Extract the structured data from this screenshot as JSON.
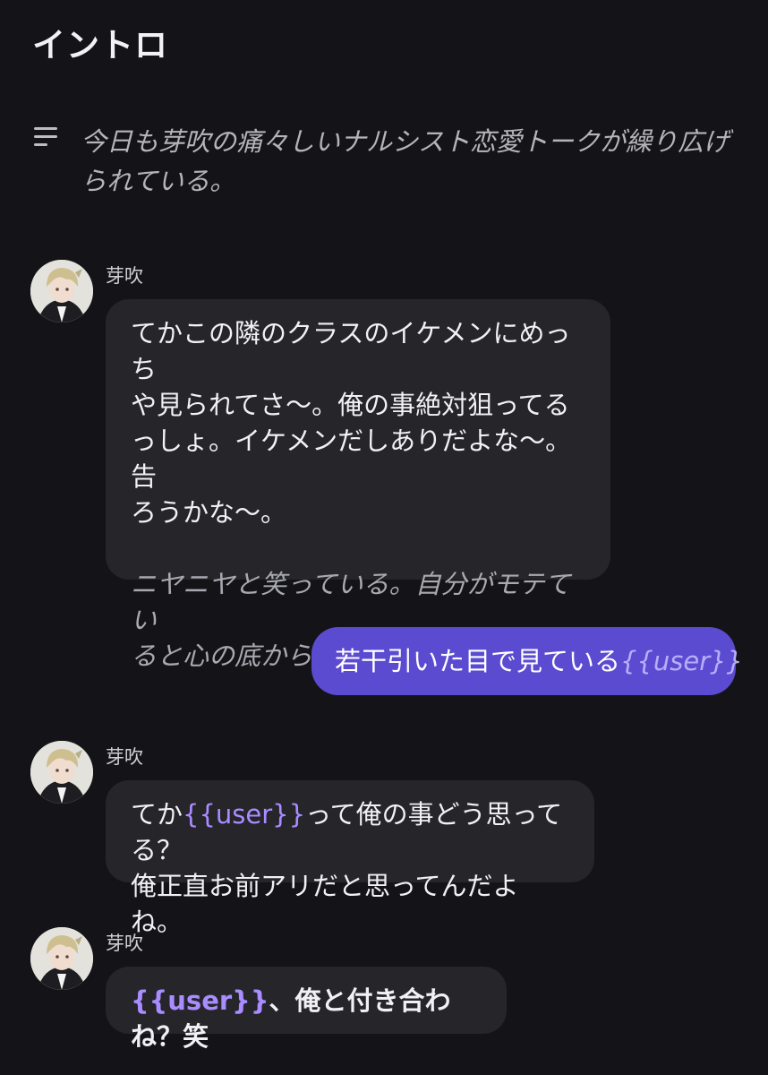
{
  "header": {
    "title": "イントロ"
  },
  "intro": {
    "icon": "list-lines-icon",
    "text": "今日も芽吹の痛々しいナルシスト恋愛トークが繰り広げられている。"
  },
  "messages": [
    {
      "sender": "芽吹",
      "avatar": "character-avatar",
      "lines": [
        "てかこの隣のクラスのイケメンにめっち",
        "や見られてさ〜。俺の事絶対狙ってる",
        "っしょ。イケメンだしありだよな〜。告",
        "ろうかな〜。"
      ],
      "narration_lines": [
        "ニヤニヤと笑っている。自分がモテてい",
        "ると心の底から思っているらしい"
      ]
    },
    {
      "role": "user",
      "text": "若干引いた目で見ている",
      "variable": "{{user}}"
    },
    {
      "sender": "芽吹",
      "avatar": "character-avatar",
      "prefix": "てか",
      "variable": "{{user}}",
      "suffix": "って俺の事どう思ってる？",
      "line2": "俺正直お前アリだと思ってんだよね。"
    },
    {
      "sender": "芽吹",
      "avatar": "character-avatar",
      "variable": "{{user}}",
      "suffix": "、俺と付き合わね？笑"
    }
  ],
  "colors": {
    "background": "#141418",
    "bot_bubble": "#25252a",
    "user_bubble": "#5b4bd1",
    "variable": "#a98cff"
  }
}
